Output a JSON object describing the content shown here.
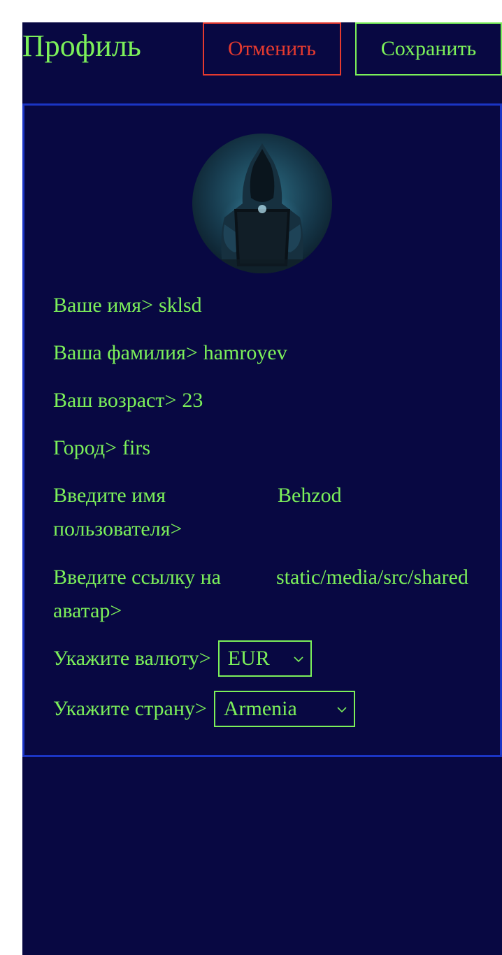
{
  "header": {
    "title": "Профиль",
    "cancel_label": "Отменить",
    "save_label": "Сохранить"
  },
  "profile": {
    "avatar_icon": "hacker-avatar-image",
    "first_name": {
      "label": "Ваше имя>",
      "value": "sklsd"
    },
    "last_name": {
      "label": "Ваша фамилия>",
      "value": "hamroyev"
    },
    "age": {
      "label": "Ваш возраст>",
      "value": "23"
    },
    "city": {
      "label": "Город>",
      "value": "firs"
    },
    "username": {
      "label": "Введите имя пользователя>",
      "value": "Behzod"
    },
    "avatar_link": {
      "label": "Введите ссылку на аватар>",
      "value": "static/media/src/shared"
    },
    "currency": {
      "label": "Укажите валюту>",
      "selected": "EUR"
    },
    "country": {
      "label": "Укажите страну>",
      "selected": "Armenia"
    }
  },
  "colors": {
    "background": "#080842",
    "text": "#7cf05a",
    "cancel": "#e53a2f",
    "card_border": "#1b35c4"
  }
}
